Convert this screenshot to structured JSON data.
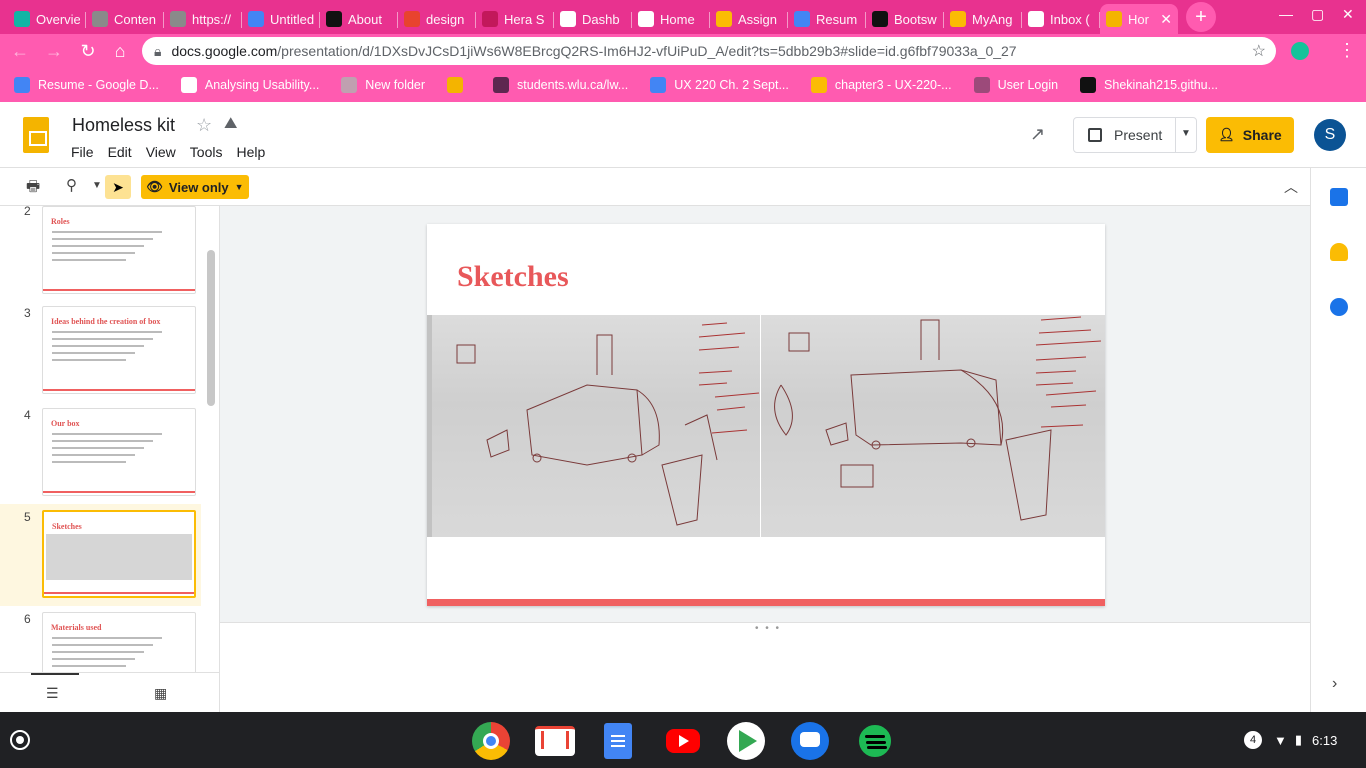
{
  "browser": {
    "tabs": [
      {
        "label": "Overvie",
        "color": "#12b5a5"
      },
      {
        "label": "Conten",
        "color": "#8a8a8a"
      },
      {
        "label": "https://",
        "color": "#8a8a8a"
      },
      {
        "label": "Untitled",
        "color": "#4285f4"
      },
      {
        "label": "About",
        "color": "#111111"
      },
      {
        "label": "design",
        "color": "#e8432e"
      },
      {
        "label": "Hera S",
        "color": "#c2185b"
      },
      {
        "label": "Dashb",
        "color": "#ffffff"
      },
      {
        "label": "Home",
        "color": "#ffffff"
      },
      {
        "label": "Assign",
        "color": "#fbbc04"
      },
      {
        "label": "Resum",
        "color": "#4285f4"
      },
      {
        "label": "Bootsw",
        "color": "#111111"
      },
      {
        "label": "MyAng",
        "color": "#fbbc04"
      },
      {
        "label": "Inbox (",
        "color": "#ffffff"
      },
      {
        "label": "Hor",
        "color": "#f4b400",
        "active": true
      }
    ],
    "url_host": "docs.google.com",
    "url_path": "/presentation/d/1DXsDvJCsD1jiWs6W8EBrcgQ2RS-Im6HJ2-vfUiPuD_A/edit?ts=5dbb29b3#slide=id.g6fbf79033a_0_27",
    "bookmarks": [
      {
        "label": "Resume - Google D...",
        "color": "#4285f4"
      },
      {
        "label": "Analysing Usability...",
        "color": "#ffffff"
      },
      {
        "label": "New folder",
        "color": "#c0a0b0"
      },
      {
        "label": "",
        "color": "#f4b400"
      },
      {
        "label": "students.wlu.ca/lw...",
        "color": "#5e2750"
      },
      {
        "label": "UX 220 Ch. 2 Sept...",
        "color": "#4285f4"
      },
      {
        "label": "chapter3 - UX-220-...",
        "color": "#fbbc04"
      },
      {
        "label": "User Login",
        "color": "#9c4a7a"
      },
      {
        "label": "Shekinah215.githu...",
        "color": "#111111"
      }
    ]
  },
  "doc": {
    "title": "Homeless kit",
    "menu": [
      "File",
      "Edit",
      "View",
      "Tools",
      "Help"
    ],
    "present_label": "Present",
    "share_label": "Share",
    "avatar_letter": "S",
    "view_only_label": "View only"
  },
  "filmstrip": {
    "slides": [
      {
        "num": "2",
        "title": "Roles"
      },
      {
        "num": "3",
        "title": "Ideas behind the creation of box"
      },
      {
        "num": "4",
        "title": "Our box"
      },
      {
        "num": "5",
        "title": "Sketches",
        "selected": true
      },
      {
        "num": "6",
        "title": "Materials used"
      }
    ]
  },
  "slide": {
    "title": "Sketches",
    "bar_color": "#f06060"
  },
  "shelf": {
    "notification_count": "4",
    "time": "6:13",
    "apps": [
      "chrome",
      "gmail",
      "docs",
      "youtube",
      "play-store",
      "messages",
      "spotify"
    ]
  }
}
